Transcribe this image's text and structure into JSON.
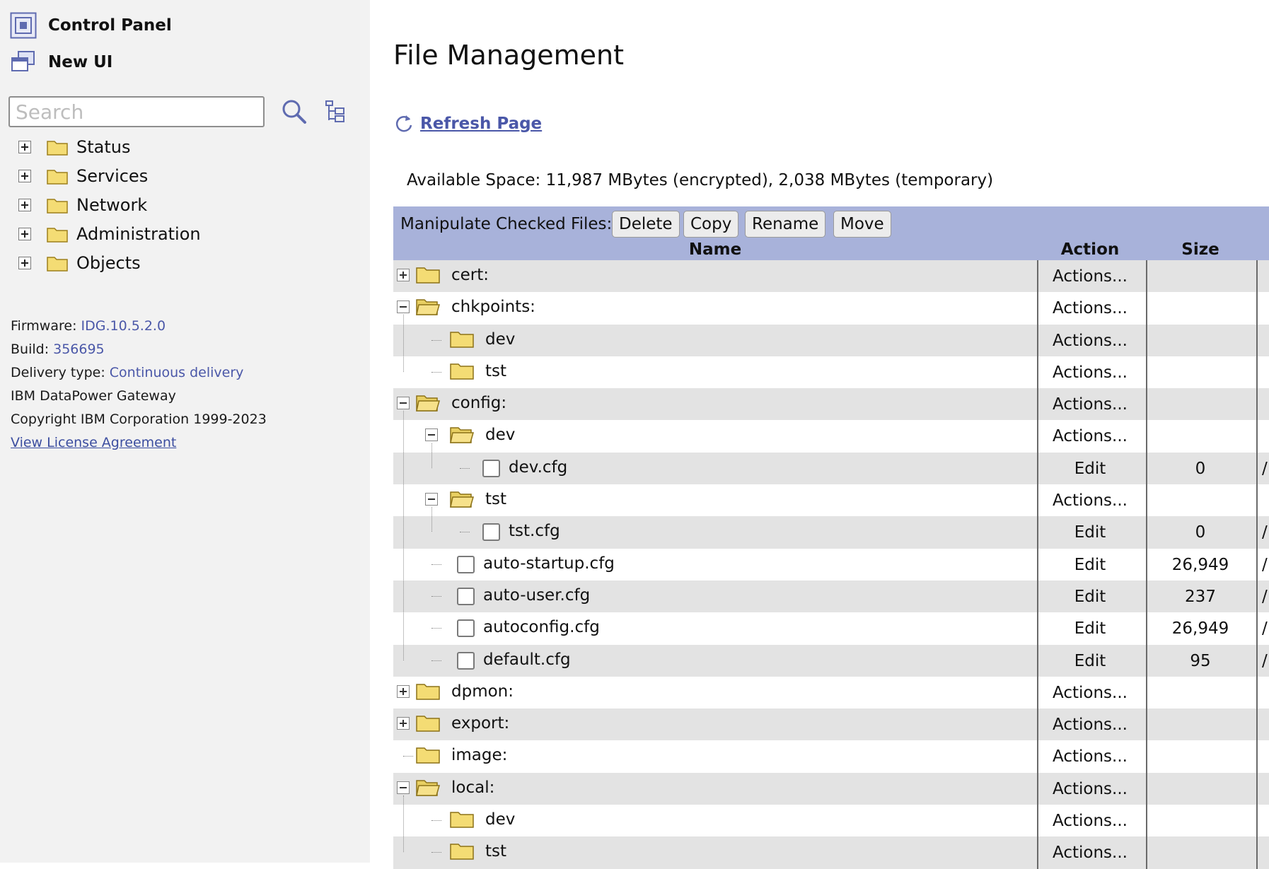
{
  "sidebar": {
    "control_panel": "Control Panel",
    "new_ui": "New UI",
    "search": {
      "placeholder": "Search",
      "value": ""
    },
    "nav": [
      {
        "label": "Status"
      },
      {
        "label": "Services"
      },
      {
        "label": "Network"
      },
      {
        "label": "Administration"
      },
      {
        "label": "Objects"
      }
    ],
    "info": {
      "firmware_label": "Firmware:",
      "firmware_value": "IDG.10.5.2.0",
      "build_label": "Build:",
      "build_value": "356695",
      "delivery_label": "Delivery type:",
      "delivery_value": "Continuous delivery",
      "product": "IBM DataPower Gateway",
      "copyright": "Copyright IBM Corporation 1999-2023",
      "license_link": "View License Agreement"
    }
  },
  "main": {
    "title": "File Management",
    "refresh": "Refresh Page",
    "available_space": "Available Space: 11,987 MBytes (encrypted), 2,038 MBytes (temporary)",
    "toolbar": {
      "label": "Manipulate Checked Files:",
      "buttons": [
        "Delete",
        "Copy",
        "Rename",
        "Move"
      ]
    },
    "columns": {
      "name": "Name",
      "action": "Action",
      "size": "Size"
    },
    "rows": [
      {
        "name": "cert:",
        "level": 0,
        "kind": "folder",
        "toggle": "plus",
        "action": "Actions...",
        "size": ""
      },
      {
        "name": "chkpoints:",
        "level": 0,
        "kind": "folder-open",
        "toggle": "minus",
        "action": "Actions...",
        "size": ""
      },
      {
        "name": "dev",
        "level": 1,
        "kind": "folder",
        "toggle": "",
        "action": "Actions...",
        "size": ""
      },
      {
        "name": "tst",
        "level": 1,
        "kind": "folder",
        "toggle": "",
        "action": "Actions...",
        "size": ""
      },
      {
        "name": "config:",
        "level": 0,
        "kind": "folder-open",
        "toggle": "minus",
        "action": "Actions...",
        "size": ""
      },
      {
        "name": "dev",
        "level": 1,
        "kind": "folder-open",
        "toggle": "minus",
        "action": "Actions...",
        "size": ""
      },
      {
        "name": "dev.cfg",
        "level": 2,
        "kind": "file",
        "toggle": "",
        "action": "Edit",
        "size": "0"
      },
      {
        "name": "tst",
        "level": 1,
        "kind": "folder-open",
        "toggle": "minus",
        "action": "Actions...",
        "size": ""
      },
      {
        "name": "tst.cfg",
        "level": 2,
        "kind": "file",
        "toggle": "",
        "action": "Edit",
        "size": "0"
      },
      {
        "name": "auto-startup.cfg",
        "level": 1,
        "kind": "file",
        "toggle": "",
        "action": "Edit",
        "size": "26,949"
      },
      {
        "name": "auto-user.cfg",
        "level": 1,
        "kind": "file",
        "toggle": "",
        "action": "Edit",
        "size": "237"
      },
      {
        "name": "autoconfig.cfg",
        "level": 1,
        "kind": "file",
        "toggle": "",
        "action": "Edit",
        "size": "26,949"
      },
      {
        "name": "default.cfg",
        "level": 1,
        "kind": "file",
        "toggle": "",
        "action": "Edit",
        "size": "95"
      },
      {
        "name": "dpmon:",
        "level": 0,
        "kind": "folder",
        "toggle": "plus",
        "action": "Actions...",
        "size": ""
      },
      {
        "name": "export:",
        "level": 0,
        "kind": "folder",
        "toggle": "plus",
        "action": "Actions...",
        "size": ""
      },
      {
        "name": "image:",
        "level": 0,
        "kind": "folder",
        "toggle": "",
        "action": "Actions...",
        "size": ""
      },
      {
        "name": "local:",
        "level": 0,
        "kind": "folder-open",
        "toggle": "minus",
        "action": "Actions...",
        "size": ""
      },
      {
        "name": "dev",
        "level": 1,
        "kind": "folder",
        "toggle": "",
        "action": "Actions...",
        "size": ""
      },
      {
        "name": "tst",
        "level": 1,
        "kind": "folder",
        "toggle": "",
        "action": "Actions...",
        "size": ""
      }
    ]
  },
  "icons": {
    "control_panel": "control-panel-icon",
    "new_ui": "new-ui-icon",
    "search": "search-icon",
    "tree": "tree-view-icon",
    "refresh": "refresh-icon",
    "folder": "folder-icon"
  },
  "colors": {
    "toolbar_bg": "#a8b2da",
    "row_shade": "#e3e3e3",
    "link": "#4a57a8",
    "sidebar_bg": "#f2f2f2",
    "folder": "#f4dc74"
  }
}
